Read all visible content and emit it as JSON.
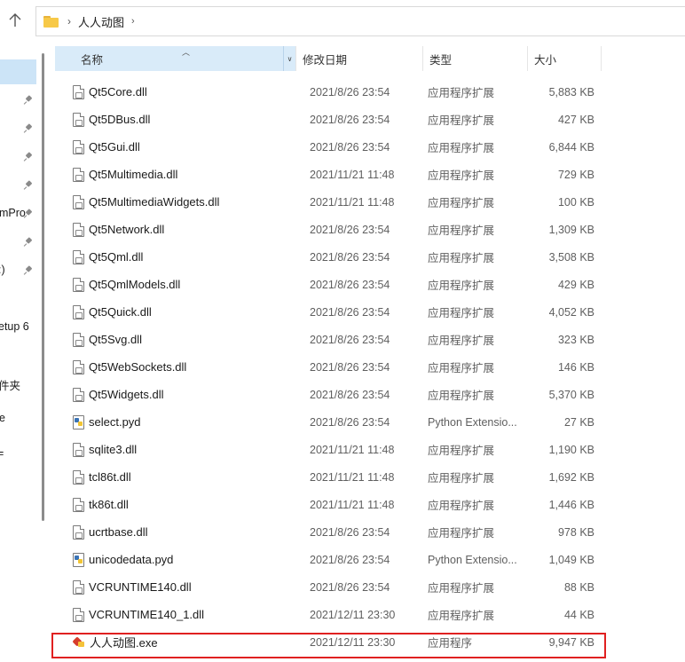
{
  "address_bar": {
    "folder_name": "人人动图",
    "separator": "›",
    "chevron": "›"
  },
  "nav_pane": {
    "labels": [
      "mPro",
      ":)",
      "etup 6",
      "件夹",
      "e",
      "="
    ]
  },
  "columns": {
    "name": "名称",
    "date": "修改日期",
    "type": "类型",
    "size": "大小"
  },
  "files": [
    {
      "name": "Qt5Core.dll",
      "date": "2021/8/26 23:54",
      "type": "应用程序扩展",
      "size": "5,883 KB",
      "icon": "dll-file-icon"
    },
    {
      "name": "Qt5DBus.dll",
      "date": "2021/8/26 23:54",
      "type": "应用程序扩展",
      "size": "427 KB",
      "icon": "dll-file-icon"
    },
    {
      "name": "Qt5Gui.dll",
      "date": "2021/8/26 23:54",
      "type": "应用程序扩展",
      "size": "6,844 KB",
      "icon": "dll-file-icon"
    },
    {
      "name": "Qt5Multimedia.dll",
      "date": "2021/11/21 11:48",
      "type": "应用程序扩展",
      "size": "729 KB",
      "icon": "dll-file-icon"
    },
    {
      "name": "Qt5MultimediaWidgets.dll",
      "date": "2021/11/21 11:48",
      "type": "应用程序扩展",
      "size": "100 KB",
      "icon": "dll-file-icon"
    },
    {
      "name": "Qt5Network.dll",
      "date": "2021/8/26 23:54",
      "type": "应用程序扩展",
      "size": "1,309 KB",
      "icon": "dll-file-icon"
    },
    {
      "name": "Qt5Qml.dll",
      "date": "2021/8/26 23:54",
      "type": "应用程序扩展",
      "size": "3,508 KB",
      "icon": "dll-file-icon"
    },
    {
      "name": "Qt5QmlModels.dll",
      "date": "2021/8/26 23:54",
      "type": "应用程序扩展",
      "size": "429 KB",
      "icon": "dll-file-icon"
    },
    {
      "name": "Qt5Quick.dll",
      "date": "2021/8/26 23:54",
      "type": "应用程序扩展",
      "size": "4,052 KB",
      "icon": "dll-file-icon"
    },
    {
      "name": "Qt5Svg.dll",
      "date": "2021/8/26 23:54",
      "type": "应用程序扩展",
      "size": "323 KB",
      "icon": "dll-file-icon"
    },
    {
      "name": "Qt5WebSockets.dll",
      "date": "2021/8/26 23:54",
      "type": "应用程序扩展",
      "size": "146 KB",
      "icon": "dll-file-icon"
    },
    {
      "name": "Qt5Widgets.dll",
      "date": "2021/8/26 23:54",
      "type": "应用程序扩展",
      "size": "5,370 KB",
      "icon": "dll-file-icon"
    },
    {
      "name": "select.pyd",
      "date": "2021/8/26 23:54",
      "type": "Python Extensio...",
      "size": "27 KB",
      "icon": "pyd-file-icon"
    },
    {
      "name": "sqlite3.dll",
      "date": "2021/11/21 11:48",
      "type": "应用程序扩展",
      "size": "1,190 KB",
      "icon": "dll-file-icon"
    },
    {
      "name": "tcl86t.dll",
      "date": "2021/11/21 11:48",
      "type": "应用程序扩展",
      "size": "1,692 KB",
      "icon": "dll-file-icon"
    },
    {
      "name": "tk86t.dll",
      "date": "2021/11/21 11:48",
      "type": "应用程序扩展",
      "size": "1,446 KB",
      "icon": "dll-file-icon"
    },
    {
      "name": "ucrtbase.dll",
      "date": "2021/8/26 23:54",
      "type": "应用程序扩展",
      "size": "978 KB",
      "icon": "dll-file-icon"
    },
    {
      "name": "unicodedata.pyd",
      "date": "2021/8/26 23:54",
      "type": "Python Extensio...",
      "size": "1,049 KB",
      "icon": "pyd-file-icon"
    },
    {
      "name": "VCRUNTIME140.dll",
      "date": "2021/8/26 23:54",
      "type": "应用程序扩展",
      "size": "88 KB",
      "icon": "dll-file-icon"
    },
    {
      "name": "VCRUNTIME140_1.dll",
      "date": "2021/12/11 23:30",
      "type": "应用程序扩展",
      "size": "44 KB",
      "icon": "dll-file-icon"
    },
    {
      "name": "人人动图.exe",
      "date": "2021/12/11 23:30",
      "type": "应用程序",
      "size": "9,947 KB",
      "icon": "exe-file-icon"
    }
  ],
  "colors": {
    "header_selected": "#d9ebf9",
    "nav_selected": "#cce4f7",
    "highlight_border": "#e02020",
    "folder": "#f7c948"
  }
}
